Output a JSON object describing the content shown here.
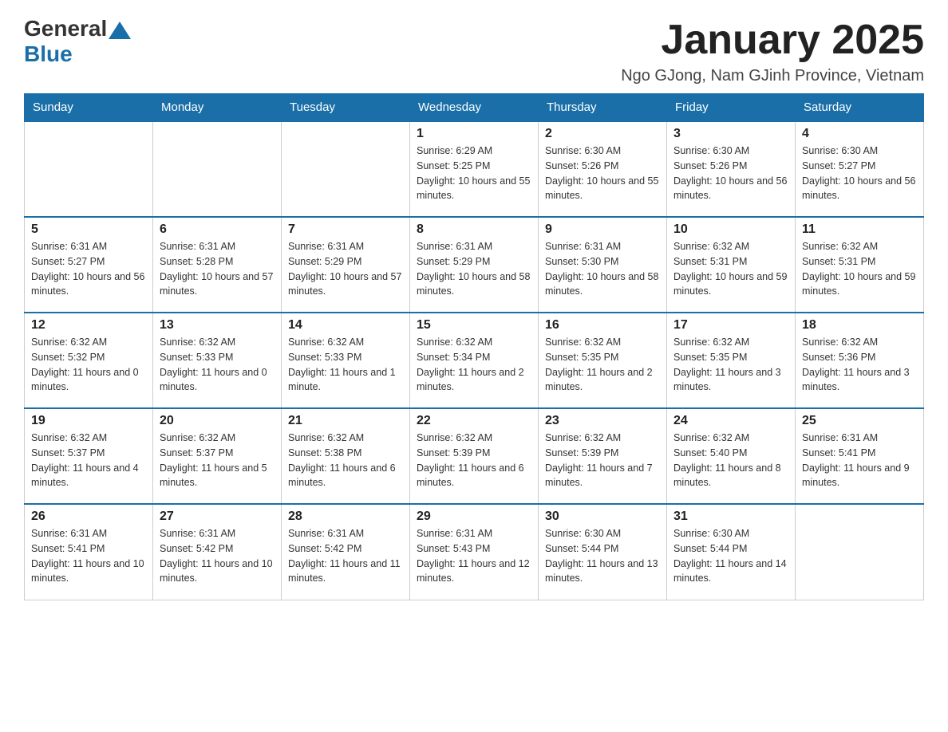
{
  "header": {
    "logo_general": "General",
    "logo_blue": "Blue",
    "title": "January 2025",
    "subtitle": "Ngo GJong, Nam GJinh Province, Vietnam"
  },
  "days_of_week": [
    "Sunday",
    "Monday",
    "Tuesday",
    "Wednesday",
    "Thursday",
    "Friday",
    "Saturday"
  ],
  "weeks": [
    [
      {
        "day": "",
        "info": ""
      },
      {
        "day": "",
        "info": ""
      },
      {
        "day": "",
        "info": ""
      },
      {
        "day": "1",
        "info": "Sunrise: 6:29 AM\nSunset: 5:25 PM\nDaylight: 10 hours and 55 minutes."
      },
      {
        "day": "2",
        "info": "Sunrise: 6:30 AM\nSunset: 5:26 PM\nDaylight: 10 hours and 55 minutes."
      },
      {
        "day": "3",
        "info": "Sunrise: 6:30 AM\nSunset: 5:26 PM\nDaylight: 10 hours and 56 minutes."
      },
      {
        "day": "4",
        "info": "Sunrise: 6:30 AM\nSunset: 5:27 PM\nDaylight: 10 hours and 56 minutes."
      }
    ],
    [
      {
        "day": "5",
        "info": "Sunrise: 6:31 AM\nSunset: 5:27 PM\nDaylight: 10 hours and 56 minutes."
      },
      {
        "day": "6",
        "info": "Sunrise: 6:31 AM\nSunset: 5:28 PM\nDaylight: 10 hours and 57 minutes."
      },
      {
        "day": "7",
        "info": "Sunrise: 6:31 AM\nSunset: 5:29 PM\nDaylight: 10 hours and 57 minutes."
      },
      {
        "day": "8",
        "info": "Sunrise: 6:31 AM\nSunset: 5:29 PM\nDaylight: 10 hours and 58 minutes."
      },
      {
        "day": "9",
        "info": "Sunrise: 6:31 AM\nSunset: 5:30 PM\nDaylight: 10 hours and 58 minutes."
      },
      {
        "day": "10",
        "info": "Sunrise: 6:32 AM\nSunset: 5:31 PM\nDaylight: 10 hours and 59 minutes."
      },
      {
        "day": "11",
        "info": "Sunrise: 6:32 AM\nSunset: 5:31 PM\nDaylight: 10 hours and 59 minutes."
      }
    ],
    [
      {
        "day": "12",
        "info": "Sunrise: 6:32 AM\nSunset: 5:32 PM\nDaylight: 11 hours and 0 minutes."
      },
      {
        "day": "13",
        "info": "Sunrise: 6:32 AM\nSunset: 5:33 PM\nDaylight: 11 hours and 0 minutes."
      },
      {
        "day": "14",
        "info": "Sunrise: 6:32 AM\nSunset: 5:33 PM\nDaylight: 11 hours and 1 minute."
      },
      {
        "day": "15",
        "info": "Sunrise: 6:32 AM\nSunset: 5:34 PM\nDaylight: 11 hours and 2 minutes."
      },
      {
        "day": "16",
        "info": "Sunrise: 6:32 AM\nSunset: 5:35 PM\nDaylight: 11 hours and 2 minutes."
      },
      {
        "day": "17",
        "info": "Sunrise: 6:32 AM\nSunset: 5:35 PM\nDaylight: 11 hours and 3 minutes."
      },
      {
        "day": "18",
        "info": "Sunrise: 6:32 AM\nSunset: 5:36 PM\nDaylight: 11 hours and 3 minutes."
      }
    ],
    [
      {
        "day": "19",
        "info": "Sunrise: 6:32 AM\nSunset: 5:37 PM\nDaylight: 11 hours and 4 minutes."
      },
      {
        "day": "20",
        "info": "Sunrise: 6:32 AM\nSunset: 5:37 PM\nDaylight: 11 hours and 5 minutes."
      },
      {
        "day": "21",
        "info": "Sunrise: 6:32 AM\nSunset: 5:38 PM\nDaylight: 11 hours and 6 minutes."
      },
      {
        "day": "22",
        "info": "Sunrise: 6:32 AM\nSunset: 5:39 PM\nDaylight: 11 hours and 6 minutes."
      },
      {
        "day": "23",
        "info": "Sunrise: 6:32 AM\nSunset: 5:39 PM\nDaylight: 11 hours and 7 minutes."
      },
      {
        "day": "24",
        "info": "Sunrise: 6:32 AM\nSunset: 5:40 PM\nDaylight: 11 hours and 8 minutes."
      },
      {
        "day": "25",
        "info": "Sunrise: 6:31 AM\nSunset: 5:41 PM\nDaylight: 11 hours and 9 minutes."
      }
    ],
    [
      {
        "day": "26",
        "info": "Sunrise: 6:31 AM\nSunset: 5:41 PM\nDaylight: 11 hours and 10 minutes."
      },
      {
        "day": "27",
        "info": "Sunrise: 6:31 AM\nSunset: 5:42 PM\nDaylight: 11 hours and 10 minutes."
      },
      {
        "day": "28",
        "info": "Sunrise: 6:31 AM\nSunset: 5:42 PM\nDaylight: 11 hours and 11 minutes."
      },
      {
        "day": "29",
        "info": "Sunrise: 6:31 AM\nSunset: 5:43 PM\nDaylight: 11 hours and 12 minutes."
      },
      {
        "day": "30",
        "info": "Sunrise: 6:30 AM\nSunset: 5:44 PM\nDaylight: 11 hours and 13 minutes."
      },
      {
        "day": "31",
        "info": "Sunrise: 6:30 AM\nSunset: 5:44 PM\nDaylight: 11 hours and 14 minutes."
      },
      {
        "day": "",
        "info": ""
      }
    ]
  ]
}
